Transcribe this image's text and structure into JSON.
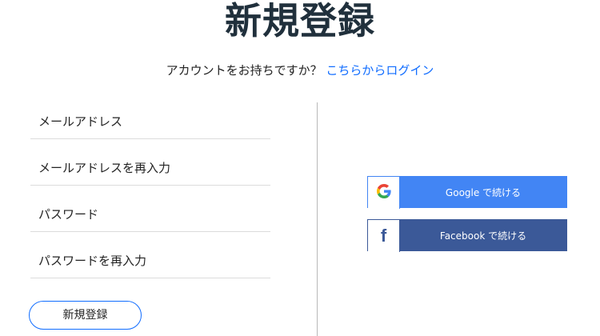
{
  "page": {
    "title": "新規登録",
    "subtitle_text": "アカウントをお持ちですか？",
    "login_link": "こちらからログイン"
  },
  "form": {
    "email_placeholder": "メールアドレス",
    "email_confirm_placeholder": "メールアドレスを再入力",
    "password_placeholder": "パスワード",
    "password_confirm_placeholder": "パスワードを再入力",
    "submit_label": "新規登録"
  },
  "social": {
    "google_label": "Google で続ける",
    "google_icon": "google-g-icon",
    "facebook_label": "Facebook で続ける",
    "facebook_icon": "facebook-f-icon",
    "facebook_glyph": "f"
  },
  "colors": {
    "link": "#116dff",
    "google": "#4285f4",
    "facebook": "#3b5998",
    "title": "#20303c"
  }
}
